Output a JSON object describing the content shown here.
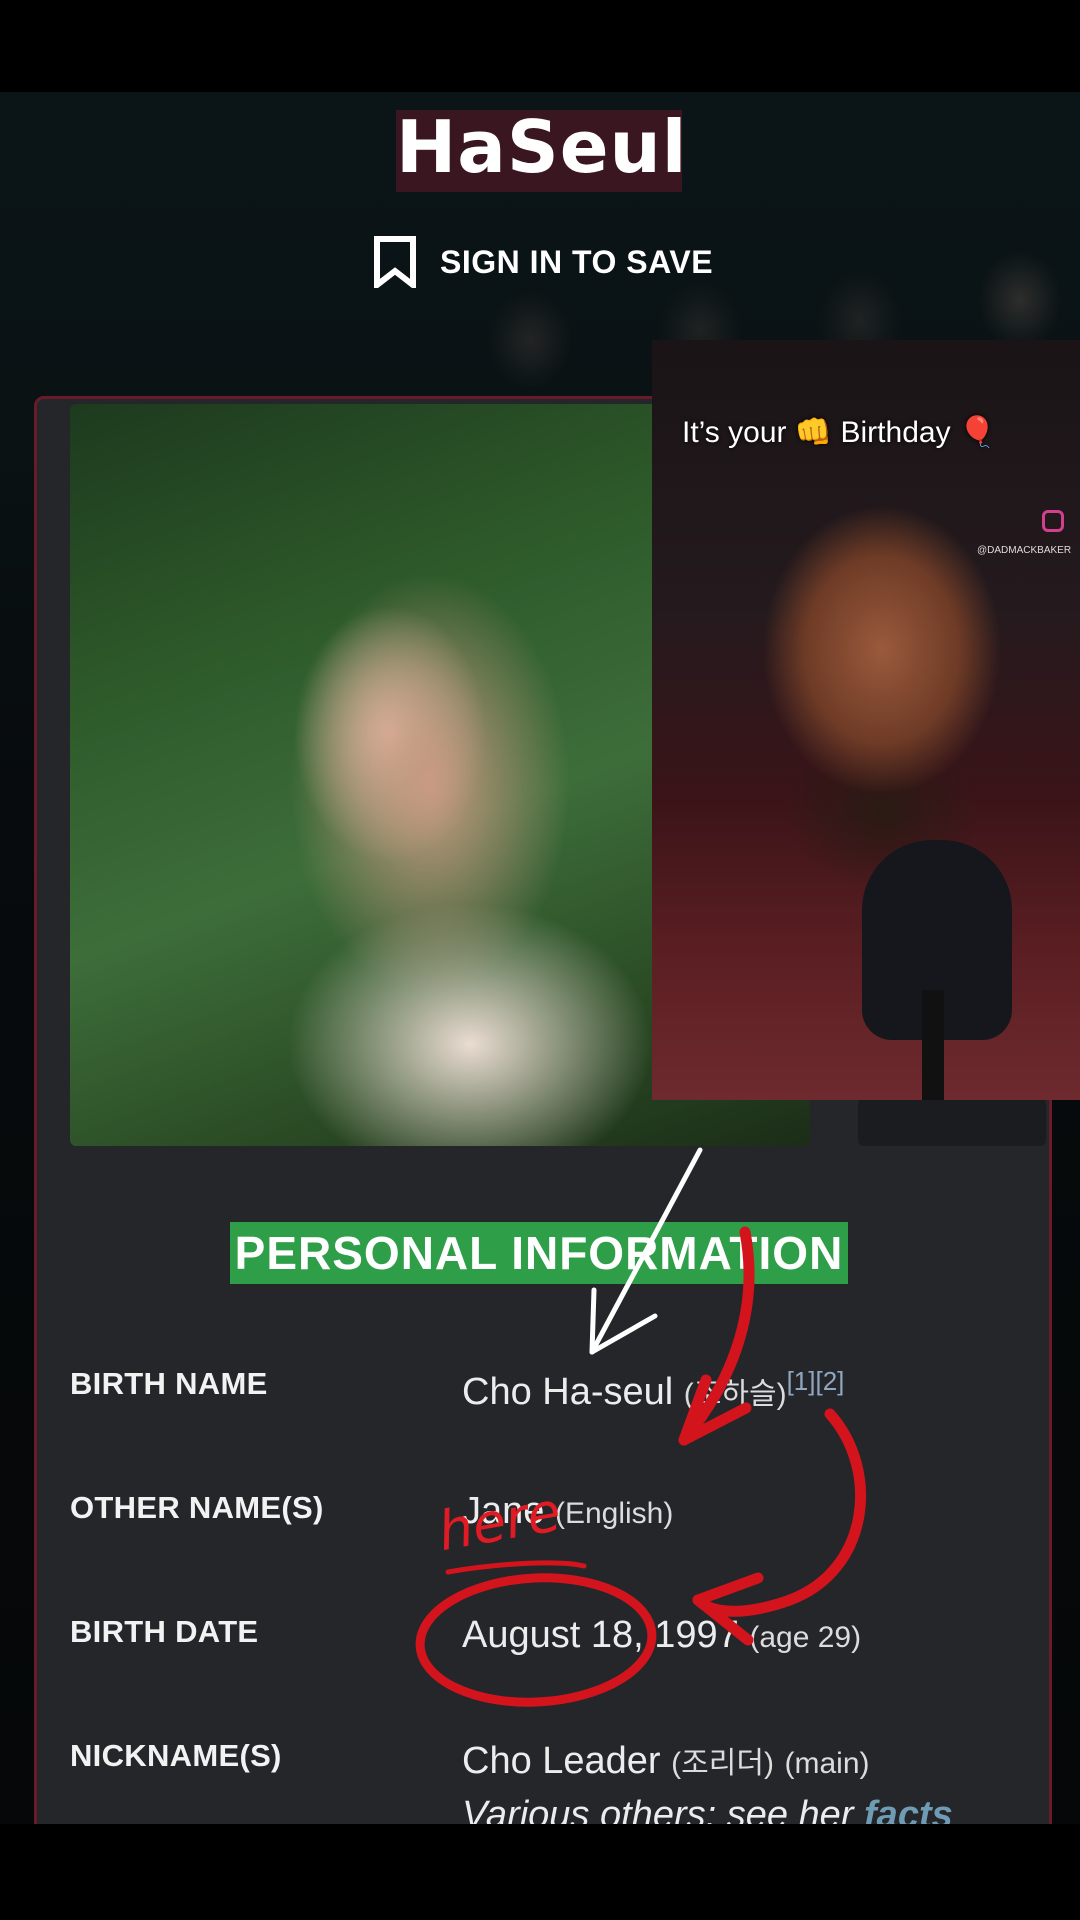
{
  "header": {
    "title": "HaSeul",
    "save_label": "SIGN IN TO SAVE",
    "save_icon": "bookmark-icon"
  },
  "video_overlay": {
    "caption": "It’s your 👊 Birthday 🎈",
    "handle": "@DADMACKBAKER"
  },
  "section": {
    "heading": "PERSONAL INFORMATION"
  },
  "info": {
    "birth_name": {
      "label": "BIRTH NAME",
      "value": "Cho Ha-seul",
      "native": "(조하슬)",
      "refs": "[1][2]"
    },
    "other_names": {
      "label": "OTHER NAME(S)",
      "value": "Jane",
      "note": "(English)"
    },
    "birth_date": {
      "label": "BIRTH DATE",
      "value": "August 18, 1997",
      "age": "(age 29)"
    },
    "nicknames": {
      "label": "NICKNAME(S)",
      "value": "Cho Leader",
      "native": "(조리더)",
      "note": "(main)",
      "more_prefix": "Various others: see her ",
      "more_link": "facts"
    }
  },
  "annotation": {
    "handwritten": "here",
    "color": "#e01b24"
  }
}
